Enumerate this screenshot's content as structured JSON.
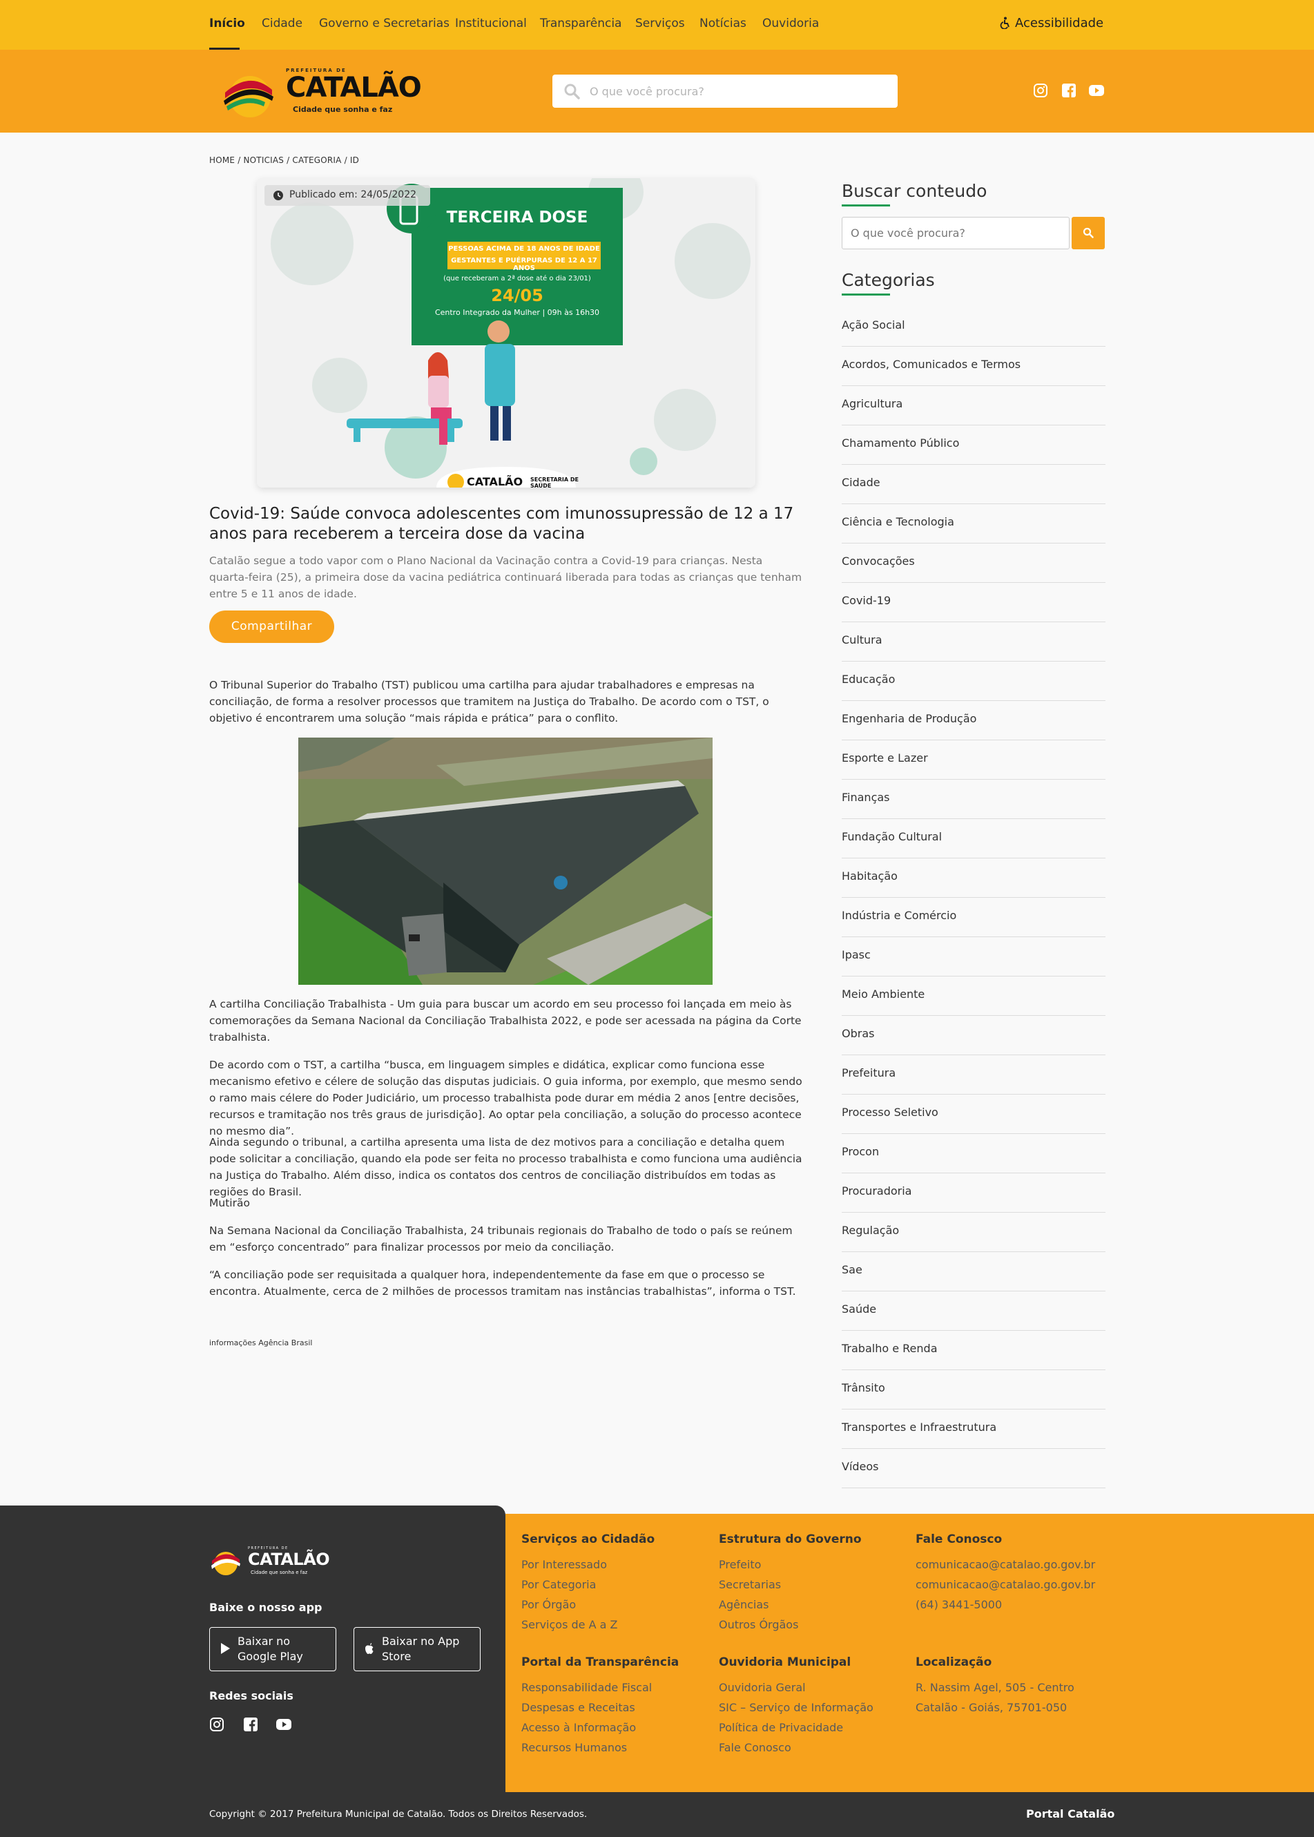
{
  "topnav": {
    "items": [
      "Início",
      "Cidade",
      "Governo e Secretarias",
      "Institucional",
      "Transparência",
      "Serviços",
      "Notícias",
      "Ouvidoria"
    ],
    "accessibility": "Acessibilidade"
  },
  "header": {
    "logo": {
      "top_text": "PREFEITURA DE",
      "name": "CATALÃO",
      "slogan": "Cidade que sonha e faz"
    },
    "search_placeholder": "O que você procura?",
    "social": [
      "instagram-icon",
      "facebook-icon",
      "youtube-icon"
    ]
  },
  "breadcrumb": "HOME / NOTICIAS / CATEGORIA / ID",
  "article": {
    "published": "Publicado em: 24/05/2022",
    "poster": {
      "title": "TERCEIRA DOSE",
      "band_line1": "PESSOAS ACIMA DE 18 ANOS DE IDADE",
      "band_line2": "GESTANTES E PUÉRPURAS DE 12 A 17 ANOS",
      "note": "(que receberam a 2ª dose até o dia 23/01)",
      "date": "24/05",
      "place": "Centro Integrado da Mulher | 09h às 16h30",
      "footer_logo": "CATALÃO",
      "footer_dept": "SECRETARIA DE SAÚDE"
    },
    "title": "Covid-19: Saúde convoca adolescentes com imunossupressão de 12 a 17 anos para receberem a terceira dose da vacina",
    "lead": "Catalão segue a todo vapor com o Plano Nacional da Vacinação contra a Covid-19 para crianças. Nesta quarta-feira (25), a primeira dose da vacina pediátrica continuará liberada para todas as crianças que tenham entre 5 e 11 anos de idade.",
    "share": "Compartilhar",
    "p1": "O Tribunal Superior do Trabalho (TST) publicou uma cartilha para ajudar trabalhadores e empresas na conciliação, de forma a resolver processos que tramitem na Justiça do Trabalho. De acordo com o TST, o objetivo é encontrarem uma solução “mais rápida e prática” para o conflito.",
    "p2": "A cartilha Conciliação Trabalhista - Um guia para buscar um acordo em seu processo foi lançada em meio às comemorações da Semana Nacional da Conciliação Trabalhista 2022, e pode ser acessada na página da Corte trabalhista.",
    "p3": "De acordo com o TST, a cartilha “busca, em linguagem simples e didática, explicar como funciona esse mecanismo efetivo e célere de solução das disputas judiciais. O guia informa, por exemplo, que mesmo sendo o ramo mais célere do Poder Judiciário, um processo trabalhista pode durar em média 2 anos [entre decisões, recursos e tramitação nos três graus de jurisdição]. Ao optar pela conciliação, a solução do processo acontece no mesmo dia”.",
    "p4": "Ainda segundo o tribunal, a cartilha apresenta uma lista de dez motivos para a conciliação e detalha quem pode solicitar a conciliação, quando ela pode ser feita no processo trabalhista e como funciona uma audiência na Justiça do Trabalho. Além disso, indica os contatos dos centros de conciliação distribuídos em todas as regiões do Brasil.",
    "p5": "Mutirão",
    "p6": "Na Semana Nacional da Conciliação Trabalhista, 24 tribunais regionais do Trabalho de todo o país se reúnem em “esforço concentrado” para finalizar processos por meio da conciliação.",
    "p7": "“A conciliação pode ser requisitada a qualquer hora, independentemente da fase em que o processo se encontra. Atualmente, cerca de 2 milhões de processos tramitam nas instâncias trabalhistas”, informa o TST.",
    "credit": "informações Agência Brasil"
  },
  "sidebar": {
    "search_title": "Buscar conteudo",
    "search_placeholder": "O que você procura?",
    "categories_title": "Categorias",
    "categories": [
      "Ação Social",
      "Acordos, Comunicados e Termos",
      "Agricultura",
      "Chamamento Público",
      "Cidade",
      "Ciência e Tecnologia",
      "Convocações",
      "Covid-19",
      "Cultura",
      "Educação",
      "Engenharia de Produção",
      "Esporte e Lazer",
      "Finanças",
      "Fundação Cultural",
      "Habitação",
      "Indústria e Comércio",
      "Ipasc",
      "Meio Ambiente",
      "Obras",
      "Prefeitura",
      "Processo Seletivo",
      "Procon",
      "Procuradoria",
      "Regulação",
      "Sae",
      "Saúde",
      "Trabalho e Renda",
      "Trânsito",
      "Transportes e Infraestrutura",
      "Vídeos"
    ]
  },
  "footer": {
    "app_title": "Baixe o nosso app",
    "google_play": [
      "Baixar no",
      "Google Play"
    ],
    "app_store": [
      "Baixar no App",
      "Store"
    ],
    "social_title": "Redes sociais",
    "columns": [
      {
        "title": "Serviços ao Cidadão",
        "links": [
          "Por Interessado",
          "Por Categoria",
          "Por Órgão",
          "Serviços de A a Z"
        ]
      },
      {
        "title": "Estrutura do Governo",
        "links": [
          "Prefeito",
          "Secretarias",
          "Agências",
          "Outros Órgãos"
        ]
      },
      {
        "title": "Fale Conosco",
        "links": [
          "comunicacao@catalao.go.gov.br",
          "comunicacao@catalao.go.gov.br",
          "(64) 3441-5000"
        ]
      },
      {
        "title": "Portal da Transparência",
        "links": [
          "Responsabilidade Fiscal",
          "Despesas e Receitas",
          "Acesso à Informação",
          "Recursos Humanos"
        ]
      },
      {
        "title": "Ouvidoria Municipal",
        "links": [
          "Ouvidoria Geral",
          "SIC – Serviço de Informação",
          "Política de Privacidade",
          "Fale Conosco"
        ]
      },
      {
        "title": "Localização",
        "links": [
          "R. Nassim Agel, 505 - Centro",
          "Catalão - Goiás, 75701-050"
        ]
      }
    ],
    "copyright": "Copyright © 2017 Prefeitura Municipal de Catalão. Todos os Direitos Reservados.",
    "portal": "Portal Catalão"
  },
  "colors": {
    "yellow": "#f8bb19",
    "orange": "#f7a21c",
    "dark": "#333333",
    "green": "#1f9d55"
  }
}
